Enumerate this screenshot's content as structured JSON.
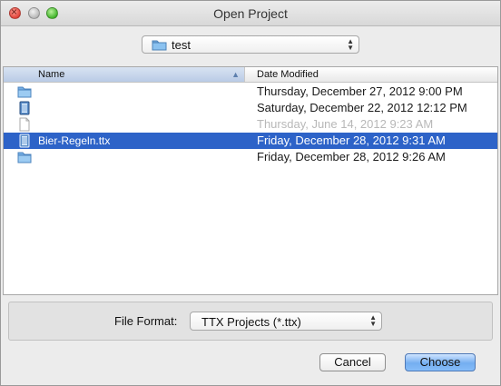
{
  "window": {
    "title": "Open Project",
    "buttons": {
      "close": "close",
      "minimize": "minimize",
      "zoom": "zoom"
    }
  },
  "location": {
    "current_folder": "test",
    "icon": "folder-icon"
  },
  "file_browser": {
    "columns": {
      "name": "Name",
      "date_modified": "Date Modified"
    },
    "rows": [
      {
        "name": "",
        "date": "Thursday, December 27, 2012 9:00 PM",
        "icon": "folder-icon",
        "state": "normal"
      },
      {
        "name": "",
        "date": "Saturday, December 22, 2012 12:12 PM",
        "icon": "project-file-icon",
        "state": "normal"
      },
      {
        "name": "",
        "date": "Thursday, June 14, 2012 9:23 AM",
        "icon": "document-icon",
        "state": "disabled"
      },
      {
        "name": "Bier-Regeln.ttx",
        "date": "Friday, December 28, 2012 9:31 AM",
        "icon": "project-file-icon",
        "state": "selected"
      },
      {
        "name": "",
        "date": "Friday, December 28, 2012 9:26 AM",
        "icon": "folder-icon",
        "state": "normal"
      }
    ]
  },
  "file_format": {
    "label": "File Format:",
    "selected": "TTX Projects (*.ttx)"
  },
  "actions": {
    "cancel": "Cancel",
    "choose": "Choose"
  },
  "colors": {
    "selection": "#2d63c8",
    "default_button": "#74aef0"
  }
}
